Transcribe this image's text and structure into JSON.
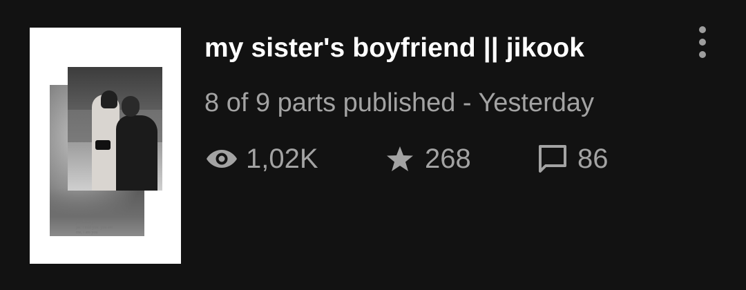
{
  "story": {
    "title": "my sister's boyfriend || jikook",
    "meta": "8 of 9 parts published - Yesterday",
    "cover": {
      "caption_lines": [
        "jk: destiny?",
        "jm: i told you. you are",
        "me, i am you"
      ]
    },
    "stats": {
      "reads": {
        "icon": "eye-icon",
        "value": "1,02K"
      },
      "votes": {
        "icon": "star-icon",
        "value": "268"
      },
      "comments": {
        "icon": "comment-icon",
        "value": "86"
      }
    },
    "menu_icon": "more-vertical-icon"
  },
  "colors": {
    "background": "#121212",
    "title": "#ffffff",
    "secondary_text": "#a3a3a3",
    "icon": "#a3a3a3"
  }
}
